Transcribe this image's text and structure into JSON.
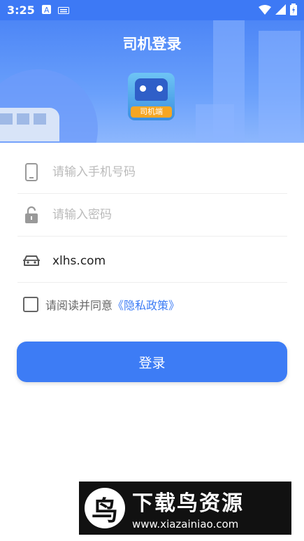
{
  "status_bar": {
    "time": "3:25",
    "icons": [
      "a-notification-icon",
      "keyboard-icon",
      "wifi-icon",
      "signal-icon",
      "battery-icon"
    ]
  },
  "header": {
    "title": "司机登录",
    "logo_label": "司机端"
  },
  "form": {
    "phone_placeholder": "请输入手机号码",
    "password_placeholder": "请输入密码",
    "server_value": "xlhs.com",
    "agree_text": "请阅读并同意",
    "policy_link": "《隐私政策》",
    "login_label": "登录"
  },
  "watermark": {
    "brand": "下载鸟资源",
    "url": "www.xiazainiao.com"
  },
  "colors": {
    "accent": "#3d7cf5",
    "header_top": "#4d86f6",
    "watermark_bg": "#111111"
  }
}
